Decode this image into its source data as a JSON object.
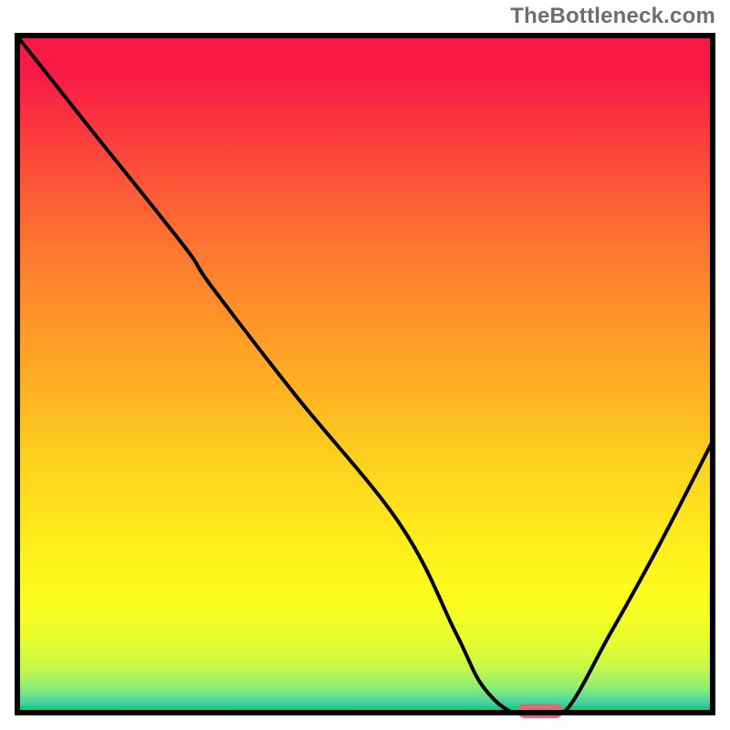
{
  "watermark": "TheBottleneck.com",
  "colors": {
    "frame_border": "#000000",
    "curve_stroke": "#000000",
    "marker_fill": "#e46a6f",
    "sweet_band": "#18cf74"
  },
  "chart_data": {
    "type": "line",
    "title": "",
    "xlabel": "",
    "ylabel": "",
    "xlim": [
      0,
      100
    ],
    "ylim": [
      0,
      100
    ],
    "series": [
      {
        "name": "bottleneck-curve",
        "x": [
          0,
          10,
          24,
          28,
          40,
          55,
          63,
          67,
          72,
          78,
          85,
          92,
          100
        ],
        "y": [
          100,
          87,
          69,
          63,
          47,
          28,
          12,
          4,
          0,
          0,
          12,
          25,
          41
        ]
      }
    ],
    "sweet_spot": {
      "x": 75,
      "y": 0.7,
      "width_pct": 6.5
    }
  }
}
